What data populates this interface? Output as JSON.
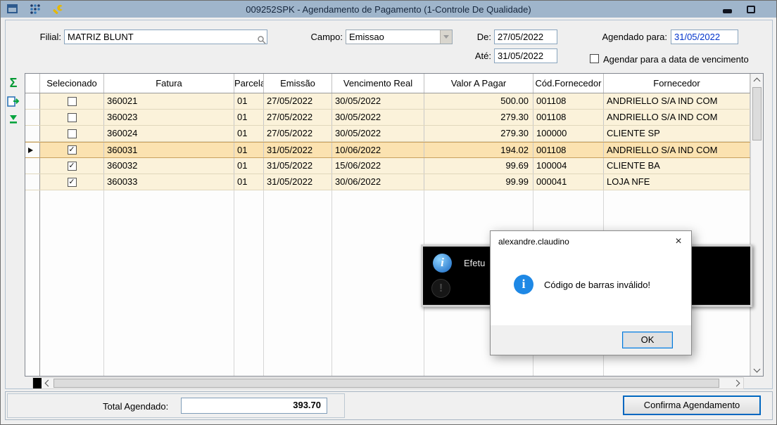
{
  "titlebar": {
    "title": "009252SPK - Agendamento de Pagamento (1-Controle De Qualidade)"
  },
  "filters": {
    "filial_label": "Filial:",
    "filial_value": "MATRIZ BLUNT",
    "campo_label": "Campo:",
    "campo_value": "Emissao",
    "de_label": "De:",
    "de_value": "27/05/2022",
    "ate_label": "Até:",
    "ate_value": "31/05/2022",
    "agendado_label": "Agendado para:",
    "agendado_value": "31/05/2022",
    "agendar_vencimento_label": "Agendar para a data de vencimento"
  },
  "icons": {
    "sum": "Σ",
    "check": "✓",
    "close": "×"
  },
  "grid": {
    "columns": {
      "selecionado": "Selecionado",
      "fatura": "Fatura",
      "parcela": "Parcela",
      "emissao": "Emissão",
      "vencimento": "Vencimento Real",
      "valor": "Valor A Pagar",
      "cod": "Cód.Fornecedor",
      "fornecedor": "Fornecedor"
    },
    "rows": [
      {
        "selected": false,
        "current": false,
        "fatura": "360021",
        "parcela": "01",
        "emissao": "27/05/2022",
        "vencimento": "30/05/2022",
        "valor": "500.00",
        "cod": "001108",
        "fornecedor": "ANDRIELLO S/A IND COM"
      },
      {
        "selected": false,
        "current": false,
        "fatura": "360023",
        "parcela": "01",
        "emissao": "27/05/2022",
        "vencimento": "30/05/2022",
        "valor": "279.30",
        "cod": "001108",
        "fornecedor": "ANDRIELLO S/A IND COM"
      },
      {
        "selected": false,
        "current": false,
        "fatura": "360024",
        "parcela": "01",
        "emissao": "27/05/2022",
        "vencimento": "30/05/2022",
        "valor": "279.30",
        "cod": "100000",
        "fornecedor": "CLIENTE SP"
      },
      {
        "selected": true,
        "current": true,
        "fatura": "360031",
        "parcela": "01",
        "emissao": "31/05/2022",
        "vencimento": "10/06/2022",
        "valor": "194.02",
        "cod": "001108",
        "fornecedor": "ANDRIELLO S/A IND COM"
      },
      {
        "selected": true,
        "current": false,
        "fatura": "360032",
        "parcela": "01",
        "emissao": "31/05/2022",
        "vencimento": "15/06/2022",
        "valor": "99.69",
        "cod": "100004",
        "fornecedor": "CLIENTE BA"
      },
      {
        "selected": true,
        "current": false,
        "fatura": "360033",
        "parcela": "01",
        "emissao": "31/05/2022",
        "vencimento": "30/06/2022",
        "valor": "99.99",
        "cod": "000041",
        "fornecedor": "LOJA NFE"
      }
    ]
  },
  "progress_dialog": {
    "text": "Efetu",
    "info_letter": "i",
    "alert_letter": "!"
  },
  "message_box": {
    "title": "alexandre.claudino",
    "message": "Código de barras inválido!",
    "ok": "OK",
    "icon_letter": "i"
  },
  "footer": {
    "total_label": "Total Agendado:",
    "total_value": "393.70",
    "confirm_label": "Confirma Agendamento"
  }
}
